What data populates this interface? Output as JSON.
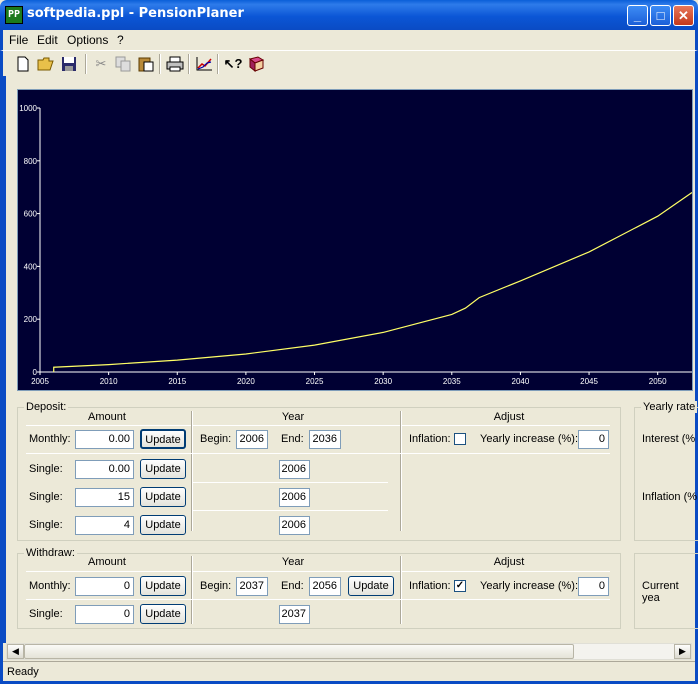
{
  "window": {
    "title": "softpedia.ppl - PensionPlaner",
    "icon_label": "PP",
    "minimize": "_",
    "maximize": "□",
    "close": "✕"
  },
  "menu": [
    "File",
    "Edit",
    "Options",
    "?"
  ],
  "toolbar_icons": [
    "new-icon",
    "open-icon",
    "save-icon",
    "cut-icon",
    "copy-icon",
    "paste-icon",
    "print-icon",
    "chart-icon",
    "help-pointer-icon",
    "book-icon"
  ],
  "chart_data": {
    "type": "line",
    "background": "#000033",
    "line_color": "#FFFF66",
    "axis_color": "#FFFFFF",
    "x": [
      2006,
      2010,
      2015,
      2020,
      2025,
      2030,
      2035,
      2036,
      2037,
      2040,
      2045,
      2050,
      2052.5
    ],
    "y": [
      18,
      28,
      45,
      68,
      102,
      150,
      218,
      242,
      282,
      345,
      455,
      590,
      680
    ],
    "xticks": [
      "2005",
      "2010",
      "2015",
      "2020",
      "2025",
      "2030",
      "2035",
      "2040",
      "2045",
      "2050"
    ],
    "yticks": [
      "0",
      "200",
      "400",
      "600",
      "800",
      "1000"
    ],
    "xlim": [
      2005,
      2052.5
    ],
    "ylim": [
      0,
      1000
    ]
  },
  "deposit": {
    "label": "Deposit:",
    "col_amount": "Amount",
    "col_year": "Year",
    "col_adjust": "Adjust",
    "monthly": {
      "label": "Monthly:",
      "amount": "0.00",
      "update": "Update",
      "begin_label": "Begin:",
      "begin": "2006",
      "end_label": "End:",
      "end": "2036",
      "inflation_label": "Inflation:",
      "inflation_checked": false,
      "yearly_label": "Yearly increase (%):",
      "yearly": "0"
    },
    "singles": [
      {
        "label": "Single:",
        "amount": "0.00",
        "update": "Update",
        "year": "2006"
      },
      {
        "label": "Single:",
        "amount": "15",
        "update": "Update",
        "year": "2006"
      },
      {
        "label": "Single:",
        "amount": "4",
        "update": "Update",
        "year": "2006"
      }
    ]
  },
  "yearly_rates": {
    "label": "Yearly rate",
    "interest": "Interest (%",
    "inflation": "Inflation (%"
  },
  "withdraw": {
    "label": "Withdraw:",
    "col_amount": "Amount",
    "col_year": "Year",
    "col_adjust": "Adjust",
    "monthly": {
      "label": "Monthly:",
      "amount": "0",
      "update": "Update",
      "begin_label": "Begin:",
      "begin": "2037",
      "end_label": "End:",
      "end": "2056",
      "update2": "Update",
      "inflation_label": "Inflation:",
      "inflation_checked": true,
      "yearly_label": "Yearly increase (%):",
      "yearly": "0"
    },
    "single": {
      "label": "Single:",
      "amount": "0",
      "update": "Update",
      "year": "2037"
    }
  },
  "current_year": {
    "label": "Current yea"
  },
  "scroll": {
    "left": "◀",
    "right": "▶"
  },
  "status": {
    "text": "Ready"
  }
}
